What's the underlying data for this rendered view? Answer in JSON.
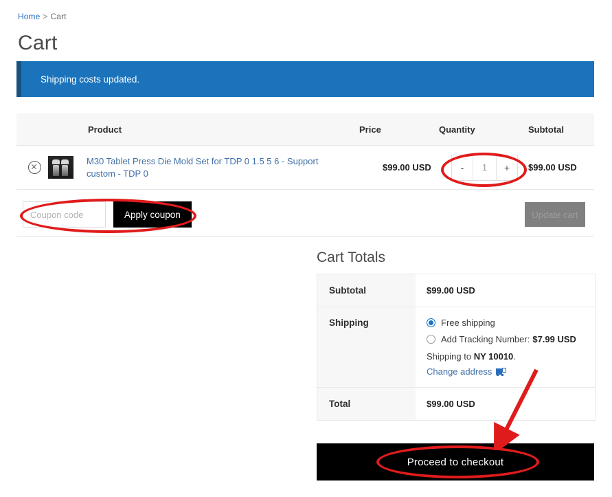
{
  "breadcrumb": {
    "home": "Home",
    "separator": ">",
    "current": "Cart"
  },
  "page_title": "Cart",
  "notice": {
    "message": "Shipping costs updated.",
    "background": "#1b74bb",
    "accent": "#17537f"
  },
  "cart_table": {
    "headers": {
      "product": "Product",
      "price": "Price",
      "quantity": "Quantity",
      "subtotal": "Subtotal"
    },
    "rows": [
      {
        "remove_icon": "remove-circle-x-icon",
        "thumbnail": "product-thumbnail",
        "name": "M30 Tablet Press Die Mold Set for TDP 0 1.5 5 6 - Support custom - TDP 0",
        "price": "$99.00 USD",
        "quantity": "1",
        "decrease_label": "-",
        "increase_label": "+",
        "subtotal": "$99.00 USD"
      }
    ]
  },
  "coupon": {
    "placeholder": "Coupon code",
    "value": "",
    "apply_label": "Apply coupon",
    "update_cart_label": "Update cart",
    "update_cart_disabled": true
  },
  "cart_totals": {
    "title": "Cart Totals",
    "subtotal_label": "Subtotal",
    "subtotal_value": "$99.00 USD",
    "shipping_label": "Shipping",
    "shipping_options": [
      {
        "label": "Free shipping",
        "price": "",
        "selected": true
      },
      {
        "label": "Add Tracking Number:",
        "price": "$7.99 USD",
        "selected": false
      }
    ],
    "shipping_to_prefix": "Shipping to",
    "shipping_to_location": "NY 10010",
    "shipping_to_suffix": ".",
    "change_address_label": "Change address",
    "change_address_icon": "shipping-address-icon",
    "total_label": "Total",
    "total_value": "$99.00 USD"
  },
  "checkout": {
    "label": "Proceed to checkout"
  },
  "annotations": {
    "highlight_color": "#e01b1b",
    "ellipses": [
      "quantity-stepper-highlight",
      "coupon-area-highlight",
      "checkout-button-highlight"
    ],
    "arrow": "arrow-pointing-to-checkout"
  }
}
